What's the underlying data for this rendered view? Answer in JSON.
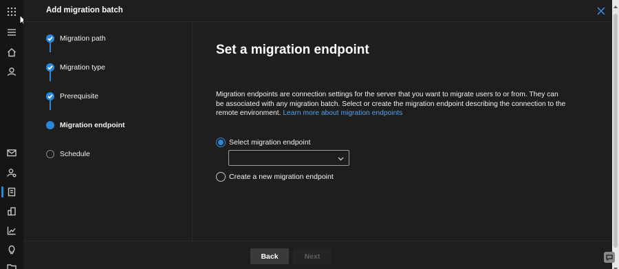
{
  "rail": {
    "icons": [
      "app-launcher-icon",
      "menu-icon",
      "home-icon",
      "user-icon",
      "mail-icon",
      "user-settings-icon",
      "migration-icon",
      "building-icon",
      "chart-icon",
      "lightbulb-icon",
      "folder-icon"
    ]
  },
  "panel": {
    "title": "Add migration batch"
  },
  "steps": [
    {
      "label": "Migration path",
      "state": "done"
    },
    {
      "label": "Migration type",
      "state": "done"
    },
    {
      "label": "Prerequisite",
      "state": "done"
    },
    {
      "label": "Migration endpoint",
      "state": "current"
    },
    {
      "label": "Schedule",
      "state": "pending"
    }
  ],
  "main": {
    "title": "Set a migration endpoint",
    "description": "Migration endpoints are connection settings for the server that you want to migrate users to or from. They can be associated with any migration batch. Select or create the migration endpoint describing the connection to the remote environment.",
    "learn_more_link": "Learn more about migration endpoints",
    "option_select": "Select migration endpoint",
    "option_create": "Create a new migration endpoint",
    "dropdown_value": ""
  },
  "footer": {
    "back_label": "Back",
    "next_label": "Next"
  },
  "colors": {
    "accent": "#2b88d8",
    "link": "#4ea2f0",
    "background": "#1f1e1d"
  }
}
